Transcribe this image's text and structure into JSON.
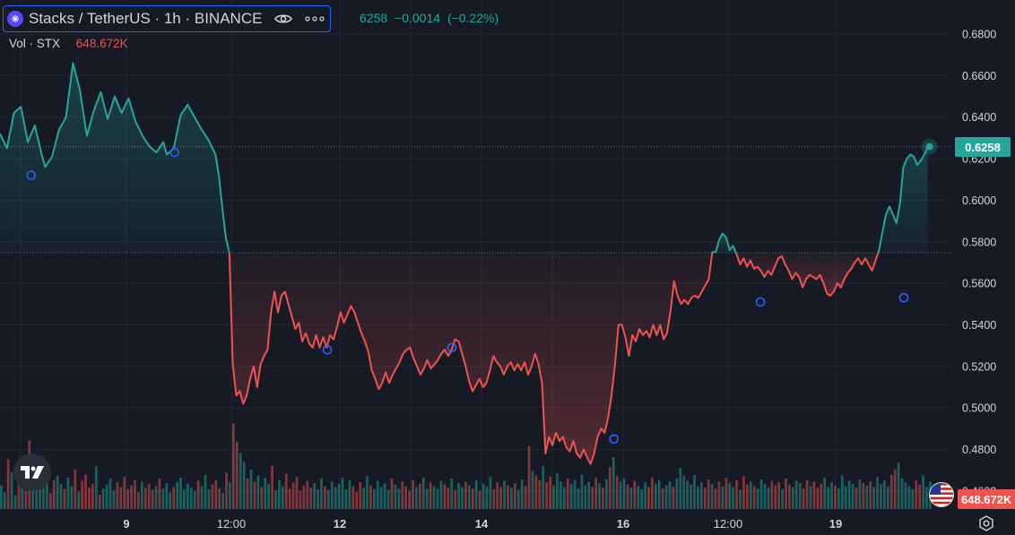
{
  "legend": {
    "title": "Stacks / TetherUS · 1h · BINANCE",
    "coin_icon": "stacks-coin-icon",
    "last": "6258",
    "change": "−0.0014",
    "change_pct": "(−0.22%)"
  },
  "volume": {
    "label": "Vol · STX",
    "value": "648.672K"
  },
  "price_tag": "0.6258",
  "volume_tag": "648.672K",
  "colors": {
    "background": "#161a25",
    "up": "#26a69a",
    "down": "#ef5350",
    "grid": "#232733",
    "accent": "#2962ff"
  },
  "chart_data": {
    "type": "area",
    "baseline": 0.5747,
    "y_axis": {
      "ticks": [
        "0.6800",
        "0.6600",
        "0.6400",
        "0.6200",
        "0.6000",
        "0.5800",
        "0.5600",
        "0.5400",
        "0.5200",
        "0.5000",
        "0.4800",
        "0.4600"
      ],
      "ylim": [
        0.455,
        0.695
      ],
      "position": "right"
    },
    "x_axis": {
      "labels": [
        {
          "text": "9",
          "bold": true
        },
        {
          "text": "12:00",
          "bold": false
        },
        {
          "text": "12",
          "bold": true
        },
        {
          "text": "14",
          "bold": true
        },
        {
          "text": "16",
          "bold": true
        },
        {
          "text": "12:00",
          "bold": false
        },
        {
          "text": "19",
          "bold": true
        }
      ]
    },
    "price_series": [
      {
        "x": 0,
        "y": 0.632
      },
      {
        "x": 2,
        "y": 0.625
      },
      {
        "x": 4,
        "y": 0.642
      },
      {
        "x": 6,
        "y": 0.645
      },
      {
        "x": 8,
        "y": 0.628
      },
      {
        "x": 10,
        "y": 0.636
      },
      {
        "x": 12,
        "y": 0.622
      },
      {
        "x": 13,
        "y": 0.616
      },
      {
        "x": 15,
        "y": 0.621
      },
      {
        "x": 17,
        "y": 0.634
      },
      {
        "x": 19,
        "y": 0.64
      },
      {
        "x": 21,
        "y": 0.666
      },
      {
        "x": 23,
        "y": 0.653
      },
      {
        "x": 25,
        "y": 0.631
      },
      {
        "x": 27,
        "y": 0.643
      },
      {
        "x": 29,
        "y": 0.652
      },
      {
        "x": 31,
        "y": 0.639
      },
      {
        "x": 33,
        "y": 0.65
      },
      {
        "x": 35,
        "y": 0.642
      },
      {
        "x": 37,
        "y": 0.649
      },
      {
        "x": 39,
        "y": 0.638
      },
      {
        "x": 41,
        "y": 0.631
      },
      {
        "x": 43,
        "y": 0.626
      },
      {
        "x": 45,
        "y": 0.623
      },
      {
        "x": 47,
        "y": 0.628
      },
      {
        "x": 48,
        "y": 0.622
      },
      {
        "x": 50,
        "y": 0.625
      },
      {
        "x": 52,
        "y": 0.641
      },
      {
        "x": 54,
        "y": 0.646
      },
      {
        "x": 56,
        "y": 0.64
      },
      {
        "x": 58,
        "y": 0.634
      },
      {
        "x": 60,
        "y": 0.629
      },
      {
        "x": 62,
        "y": 0.622
      },
      {
        "x": 63,
        "y": 0.612
      },
      {
        "x": 64,
        "y": 0.596
      },
      {
        "x": 65,
        "y": 0.582
      },
      {
        "x": 66,
        "y": 0.5747
      },
      {
        "x": 67,
        "y": 0.521
      },
      {
        "x": 68,
        "y": 0.506
      },
      {
        "x": 69,
        "y": 0.508
      },
      {
        "x": 70,
        "y": 0.502
      },
      {
        "x": 71,
        "y": 0.506
      },
      {
        "x": 72,
        "y": 0.514
      },
      {
        "x": 73,
        "y": 0.52
      },
      {
        "x": 74,
        "y": 0.51
      },
      {
        "x": 75,
        "y": 0.521
      },
      {
        "x": 76,
        "y": 0.525
      },
      {
        "x": 77,
        "y": 0.528
      },
      {
        "x": 78,
        "y": 0.546
      },
      {
        "x": 79,
        "y": 0.556
      },
      {
        "x": 80,
        "y": 0.546
      },
      {
        "x": 81,
        "y": 0.554
      },
      {
        "x": 82,
        "y": 0.556
      },
      {
        "x": 83,
        "y": 0.55
      },
      {
        "x": 84,
        "y": 0.544
      },
      {
        "x": 85,
        "y": 0.538
      },
      {
        "x": 86,
        "y": 0.541
      },
      {
        "x": 87,
        "y": 0.532
      },
      {
        "x": 88,
        "y": 0.536
      },
      {
        "x": 89,
        "y": 0.531
      },
      {
        "x": 90,
        "y": 0.529
      },
      {
        "x": 91,
        "y": 0.535
      },
      {
        "x": 92,
        "y": 0.529
      },
      {
        "x": 93,
        "y": 0.534
      },
      {
        "x": 94,
        "y": 0.529
      },
      {
        "x": 95,
        "y": 0.535
      },
      {
        "x": 96,
        "y": 0.533
      },
      {
        "x": 97,
        "y": 0.539
      },
      {
        "x": 98,
        "y": 0.546
      },
      {
        "x": 99,
        "y": 0.541
      },
      {
        "x": 100,
        "y": 0.545
      },
      {
        "x": 101,
        "y": 0.549
      },
      {
        "x": 102,
        "y": 0.546
      },
      {
        "x": 103,
        "y": 0.541
      },
      {
        "x": 104,
        "y": 0.536
      },
      {
        "x": 105,
        "y": 0.532
      },
      {
        "x": 106,
        "y": 0.527
      },
      {
        "x": 107,
        "y": 0.518
      },
      {
        "x": 108,
        "y": 0.514
      },
      {
        "x": 109,
        "y": 0.509
      },
      {
        "x": 110,
        "y": 0.512
      },
      {
        "x": 111,
        "y": 0.517
      },
      {
        "x": 112,
        "y": 0.512
      },
      {
        "x": 113,
        "y": 0.516
      },
      {
        "x": 114,
        "y": 0.519
      },
      {
        "x": 115,
        "y": 0.522
      },
      {
        "x": 116,
        "y": 0.526
      },
      {
        "x": 117,
        "y": 0.528
      },
      {
        "x": 118,
        "y": 0.529
      },
      {
        "x": 119,
        "y": 0.524
      },
      {
        "x": 120,
        "y": 0.52
      },
      {
        "x": 121,
        "y": 0.516
      },
      {
        "x": 122,
        "y": 0.519
      },
      {
        "x": 123,
        "y": 0.523
      },
      {
        "x": 124,
        "y": 0.519
      },
      {
        "x": 125,
        "y": 0.521
      },
      {
        "x": 126,
        "y": 0.523
      },
      {
        "x": 127,
        "y": 0.526
      },
      {
        "x": 128,
        "y": 0.528
      },
      {
        "x": 129,
        "y": 0.525
      },
      {
        "x": 130,
        "y": 0.528
      },
      {
        "x": 131,
        "y": 0.533
      },
      {
        "x": 132,
        "y": 0.532
      },
      {
        "x": 133,
        "y": 0.526
      },
      {
        "x": 134,
        "y": 0.52
      },
      {
        "x": 135,
        "y": 0.513
      },
      {
        "x": 136,
        "y": 0.508
      },
      {
        "x": 137,
        "y": 0.511
      },
      {
        "x": 138,
        "y": 0.514
      },
      {
        "x": 139,
        "y": 0.51
      },
      {
        "x": 140,
        "y": 0.512
      },
      {
        "x": 141,
        "y": 0.518
      },
      {
        "x": 142,
        "y": 0.525
      },
      {
        "x": 143,
        "y": 0.522
      },
      {
        "x": 144,
        "y": 0.52
      },
      {
        "x": 145,
        "y": 0.516
      },
      {
        "x": 146,
        "y": 0.52
      },
      {
        "x": 147,
        "y": 0.522
      },
      {
        "x": 148,
        "y": 0.518
      },
      {
        "x": 149,
        "y": 0.521
      },
      {
        "x": 150,
        "y": 0.518
      },
      {
        "x": 151,
        "y": 0.522
      },
      {
        "x": 152,
        "y": 0.516
      },
      {
        "x": 153,
        "y": 0.52
      },
      {
        "x": 154,
        "y": 0.526
      },
      {
        "x": 155,
        "y": 0.521
      },
      {
        "x": 156,
        "y": 0.512
      },
      {
        "x": 157,
        "y": 0.478
      },
      {
        "x": 158,
        "y": 0.486
      },
      {
        "x": 159,
        "y": 0.482
      },
      {
        "x": 160,
        "y": 0.488
      },
      {
        "x": 161,
        "y": 0.484
      },
      {
        "x": 162,
        "y": 0.486
      },
      {
        "x": 163,
        "y": 0.481
      },
      {
        "x": 164,
        "y": 0.479
      },
      {
        "x": 165,
        "y": 0.484
      },
      {
        "x": 166,
        "y": 0.478
      },
      {
        "x": 167,
        "y": 0.476
      },
      {
        "x": 168,
        "y": 0.48
      },
      {
        "x": 169,
        "y": 0.476
      },
      {
        "x": 170,
        "y": 0.473
      },
      {
        "x": 171,
        "y": 0.478
      },
      {
        "x": 172,
        "y": 0.486
      },
      {
        "x": 173,
        "y": 0.49
      },
      {
        "x": 174,
        "y": 0.488
      },
      {
        "x": 175,
        "y": 0.495
      },
      {
        "x": 176,
        "y": 0.506
      },
      {
        "x": 177,
        "y": 0.521
      },
      {
        "x": 178,
        "y": 0.54
      },
      {
        "x": 179,
        "y": 0.54
      },
      {
        "x": 180,
        "y": 0.534
      },
      {
        "x": 181,
        "y": 0.525
      },
      {
        "x": 182,
        "y": 0.535
      },
      {
        "x": 183,
        "y": 0.532
      },
      {
        "x": 184,
        "y": 0.538
      },
      {
        "x": 185,
        "y": 0.535
      },
      {
        "x": 186,
        "y": 0.537
      },
      {
        "x": 187,
        "y": 0.534
      },
      {
        "x": 188,
        "y": 0.54
      },
      {
        "x": 189,
        "y": 0.535
      },
      {
        "x": 190,
        "y": 0.54
      },
      {
        "x": 191,
        "y": 0.533
      },
      {
        "x": 192,
        "y": 0.536
      },
      {
        "x": 193,
        "y": 0.547
      },
      {
        "x": 194,
        "y": 0.561
      },
      {
        "x": 195,
        "y": 0.554
      },
      {
        "x": 196,
        "y": 0.55
      },
      {
        "x": 197,
        "y": 0.552
      },
      {
        "x": 198,
        "y": 0.55
      },
      {
        "x": 199,
        "y": 0.553
      },
      {
        "x": 200,
        "y": 0.554
      },
      {
        "x": 201,
        "y": 0.553
      },
      {
        "x": 202,
        "y": 0.556
      },
      {
        "x": 203,
        "y": 0.559
      },
      {
        "x": 204,
        "y": 0.562
      },
      {
        "x": 205,
        "y": 0.575
      },
      {
        "x": 206,
        "y": 0.575
      },
      {
        "x": 207,
        "y": 0.581
      },
      {
        "x": 208,
        "y": 0.584
      },
      {
        "x": 209,
        "y": 0.582
      },
      {
        "x": 210,
        "y": 0.576
      },
      {
        "x": 211,
        "y": 0.578
      },
      {
        "x": 212,
        "y": 0.574
      },
      {
        "x": 213,
        "y": 0.569
      },
      {
        "x": 214,
        "y": 0.572
      },
      {
        "x": 215,
        "y": 0.568
      },
      {
        "x": 216,
        "y": 0.571
      },
      {
        "x": 217,
        "y": 0.567
      },
      {
        "x": 218,
        "y": 0.568
      },
      {
        "x": 219,
        "y": 0.566
      },
      {
        "x": 220,
        "y": 0.563
      },
      {
        "x": 221,
        "y": 0.566
      },
      {
        "x": 222,
        "y": 0.564
      },
      {
        "x": 223,
        "y": 0.568
      },
      {
        "x": 224,
        "y": 0.572
      },
      {
        "x": 225,
        "y": 0.573
      },
      {
        "x": 226,
        "y": 0.569
      },
      {
        "x": 227,
        "y": 0.566
      },
      {
        "x": 228,
        "y": 0.562
      },
      {
        "x": 229,
        "y": 0.565
      },
      {
        "x": 230,
        "y": 0.563
      },
      {
        "x": 231,
        "y": 0.558
      },
      {
        "x": 232,
        "y": 0.562
      },
      {
        "x": 233,
        "y": 0.564
      },
      {
        "x": 234,
        "y": 0.563
      },
      {
        "x": 235,
        "y": 0.562
      },
      {
        "x": 236,
        "y": 0.564
      },
      {
        "x": 237,
        "y": 0.56
      },
      {
        "x": 238,
        "y": 0.555
      },
      {
        "x": 239,
        "y": 0.554
      },
      {
        "x": 240,
        "y": 0.556
      },
      {
        "x": 241,
        "y": 0.56
      },
      {
        "x": 242,
        "y": 0.558
      },
      {
        "x": 243,
        "y": 0.562
      },
      {
        "x": 244,
        "y": 0.565
      },
      {
        "x": 245,
        "y": 0.567
      },
      {
        "x": 246,
        "y": 0.57
      },
      {
        "x": 247,
        "y": 0.572
      },
      {
        "x": 248,
        "y": 0.569
      },
      {
        "x": 249,
        "y": 0.572
      },
      {
        "x": 250,
        "y": 0.569
      },
      {
        "x": 251,
        "y": 0.566
      },
      {
        "x": 252,
        "y": 0.571
      },
      {
        "x": 253,
        "y": 0.576
      },
      {
        "x": 254,
        "y": 0.585
      },
      {
        "x": 255,
        "y": 0.593
      },
      {
        "x": 256,
        "y": 0.597
      },
      {
        "x": 257,
        "y": 0.593
      },
      {
        "x": 258,
        "y": 0.589
      },
      {
        "x": 259,
        "y": 0.598
      },
      {
        "x": 260,
        "y": 0.616
      },
      {
        "x": 261,
        "y": 0.62
      },
      {
        "x": 262,
        "y": 0.622
      },
      {
        "x": 263,
        "y": 0.621
      },
      {
        "x": 264,
        "y": 0.617
      },
      {
        "x": 265,
        "y": 0.619
      },
      {
        "x": 266,
        "y": 0.622
      },
      {
        "x": 267,
        "y": 0.6258
      }
    ],
    "markers": [
      {
        "x": 10,
        "y": 0.612
      },
      {
        "x": 56,
        "y": 0.623
      },
      {
        "x": 105,
        "y": 0.528
      },
      {
        "x": 145,
        "y": 0.529
      },
      {
        "x": 197,
        "y": 0.485
      },
      {
        "x": 244,
        "y": 0.551
      },
      {
        "x": 290,
        "y": 0.553
      }
    ],
    "volume_series": [
      31,
      22,
      65,
      48,
      18,
      36,
      42,
      24,
      90,
      28,
      34,
      47,
      29,
      55,
      21,
      38,
      44,
      33,
      26,
      41,
      30,
      52,
      23,
      37,
      45,
      28,
      33,
      56,
      19,
      27,
      32,
      40,
      24,
      35,
      29,
      42,
      26,
      31,
      38,
      22,
      36,
      28,
      33,
      25,
      30,
      40,
      27,
      34,
      22,
      29,
      35,
      41,
      26,
      33,
      28,
      24,
      37,
      30,
      45,
      26,
      32,
      38,
      27,
      21,
      48,
      35,
      112,
      88,
      74,
      62,
      40,
      52,
      36,
      44,
      29,
      41,
      33,
      57,
      25,
      38,
      30,
      46,
      27,
      35,
      42,
      24,
      31,
      37,
      28,
      34,
      26,
      40,
      30,
      25,
      36,
      29,
      33,
      41,
      26,
      38,
      30,
      22,
      35,
      28,
      43,
      31,
      26,
      37,
      29,
      34,
      25,
      40,
      32,
      27,
      36,
      30,
      24,
      38,
      29,
      33,
      41,
      27,
      35,
      30,
      26,
      37,
      32,
      28,
      40,
      25,
      34,
      29,
      36,
      31,
      27,
      38,
      24,
      33,
      30,
      42,
      26,
      35,
      29,
      37,
      31,
      28,
      34,
      25,
      39,
      30,
      83,
      50,
      44,
      38,
      56,
      35,
      42,
      31,
      47,
      36,
      29,
      40,
      33,
      38,
      27,
      45,
      31,
      36,
      29,
      41,
      34,
      28,
      39,
      55,
      68,
      43,
      36,
      40,
      32,
      28,
      37,
      30,
      26,
      35,
      29,
      41,
      33,
      38,
      27,
      31,
      36,
      29,
      40,
      54,
      44,
      37,
      32,
      45,
      30,
      35,
      28,
      39,
      33,
      27,
      36,
      30,
      41,
      34,
      29,
      38,
      25,
      43,
      32,
      36,
      30,
      27,
      39,
      33,
      28,
      37,
      31,
      35,
      26,
      40,
      32,
      29,
      37,
      34,
      27,
      38,
      30,
      36,
      28,
      33,
      41,
      29,
      35,
      31,
      27,
      44,
      30,
      37,
      33,
      28,
      39,
      34,
      31,
      36,
      29,
      42,
      33,
      38,
      30,
      45,
      52,
      61,
      40,
      35,
      30,
      26,
      38,
      32,
      44,
      29,
      36
    ]
  }
}
